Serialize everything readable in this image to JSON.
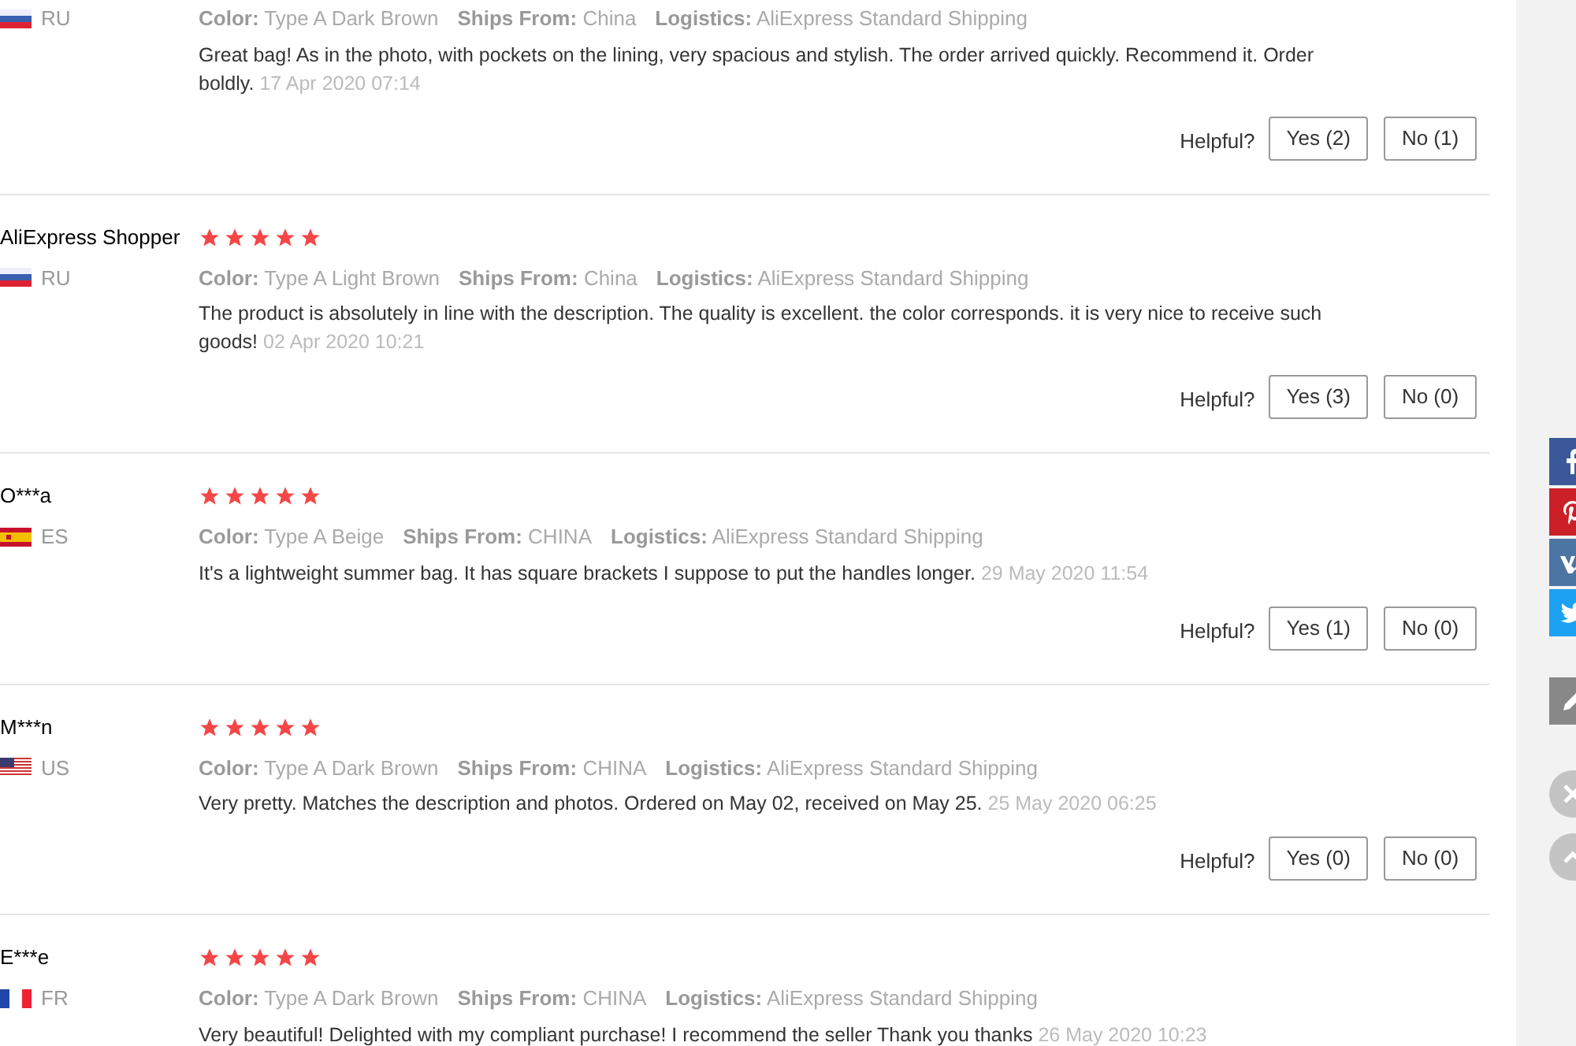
{
  "reviews": [
    {
      "kind": "ru",
      "country": "RU",
      "attributes": [
        {
          "label": "Color:",
          "value": "Type A Dark Brown"
        },
        {
          "label": "Ships From:",
          "value": "China"
        },
        {
          "label": "Logistics:",
          "value": "AliExpress Standard Shipping"
        }
      ],
      "text": "Great bag! As in the photo, with pockets on the lining, very spacious and stylish. The order arrived quickly. Recommend it. Order boldly.",
      "date": "17 Apr 2020 07:14",
      "helpful": "Helpful?",
      "yes": "Yes (2)",
      "no": "No (1)"
    },
    {
      "name": "AliExpress Shopper",
      "stars": 5,
      "kind": "ru",
      "country": "RU",
      "attributes": [
        {
          "label": "Color:",
          "value": "Type A Light Brown"
        },
        {
          "label": "Ships From:",
          "value": "China"
        },
        {
          "label": "Logistics:",
          "value": "AliExpress Standard Shipping"
        }
      ],
      "text": "The product is absolutely in line with the description. The quality is excellent. the color corresponds. it is very nice to receive such goods!",
      "date": "02 Apr 2020 10:21",
      "helpful": "Helpful?",
      "yes": "Yes (3)",
      "no": "No (0)"
    },
    {
      "name": "O***a",
      "stars": 5,
      "kind": "es",
      "country": "ES",
      "attributes": [
        {
          "label": "Color:",
          "value": "Type A Beige"
        },
        {
          "label": "Ships From:",
          "value": "CHINA"
        },
        {
          "label": "Logistics:",
          "value": "AliExpress Standard Shipping"
        }
      ],
      "text": "It's a lightweight summer bag. It has square brackets I suppose to put the handles longer.",
      "date": "29 May 2020 11:54",
      "helpful": "Helpful?",
      "yes": "Yes (1)",
      "no": "No (0)"
    },
    {
      "name": "M***n",
      "stars": 5,
      "kind": "us",
      "country": "US",
      "attributes": [
        {
          "label": "Color:",
          "value": "Type A Dark Brown"
        },
        {
          "label": "Ships From:",
          "value": "CHINA"
        },
        {
          "label": "Logistics:",
          "value": "AliExpress Standard Shipping"
        }
      ],
      "text": "Very pretty. Matches the description and photos. Ordered on May 02, received on May 25.",
      "date": "25 May 2020 06:25",
      "helpful": "Helpful?",
      "yes": "Yes (0)",
      "no": "No (0)"
    },
    {
      "name": "E***e",
      "stars": 5,
      "kind": "fr",
      "country": "FR",
      "attributes": [
        {
          "label": "Color:",
          "value": "Type A Dark Brown"
        },
        {
          "label": "Ships From:",
          "value": "CHINA"
        },
        {
          "label": "Logistics:",
          "value": "AliExpress Standard Shipping"
        }
      ],
      "text": "Very beautiful! Delighted with my compliant purchase! I recommend the seller Thank you thanks",
      "date": "26 May 2020 10:23"
    }
  ]
}
